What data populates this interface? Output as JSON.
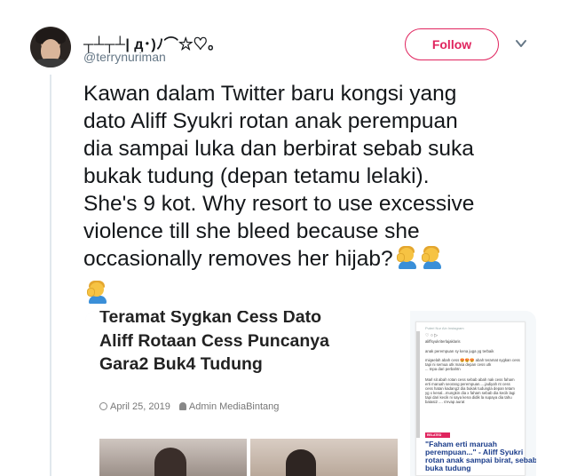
{
  "user": {
    "display_name": "┬┴┬┴| д･)ﾉ⌒☆♡｡",
    "handle": "@terrynuriman"
  },
  "actions": {
    "follow_label": "Follow",
    "more_icon": "chevron-down-icon"
  },
  "tweet": {
    "lines": [
      "Kawan dalam Twitter baru kongsi yang",
      "dato Aliff Syukri rotan anak perempuan",
      "dia sampai luka dan berbirat sebab suka",
      "bukak tudung (depan tetamu lelaki).",
      "She's 9 kot. Why resort to use excessive",
      "violence till she bleed because she",
      "occasionally removes her hijab?"
    ],
    "emoji": "woman-facepalming-icon"
  },
  "media": {
    "article": {
      "title_lines": [
        "Teramat Sygkan Cess Dato",
        "Aliff Rotaan Cess Puncanya",
        "Gara2 Buk4 Tudung"
      ],
      "date": "April 25, 2019",
      "author": "Admin MediaBintang"
    },
    "instagram": {
      "header": "Puteri Nur Ain Instagram",
      "line1": "aliffsyukriterlajaklaris",
      "caption_lines": [
        "anak perempuan sy kena juga yg terbaik",
        "",
        "miqaelah abah cess 😍😍😍 abah teramat sygkan cess",
        "tapi ni semua utk masa depan cess utk",
        "... tnpa dari perbahtn",
        "",
        "Marl sit abah rotan cess sebab abah nak cess faham",
        "erti maruah seorang perempuan.....jadiyah nt cess",
        "cess hatan kadang2 dia bukak tudungla depan tetam",
        "yg x kenal...mungkin dia x faham sebab dia kecik lagi",
        "tapi dari kecik ni saya kena didik la supaya dia tahu",
        "batasi2 .... s'evap aurat"
      ],
      "badge": "RELATED",
      "quote_lines": [
        "\"Faham erti maruah",
        "perempuan...\" - Aliff Syukri",
        "rotan anak sampai birat, sebab",
        "buka tudung"
      ]
    }
  }
}
